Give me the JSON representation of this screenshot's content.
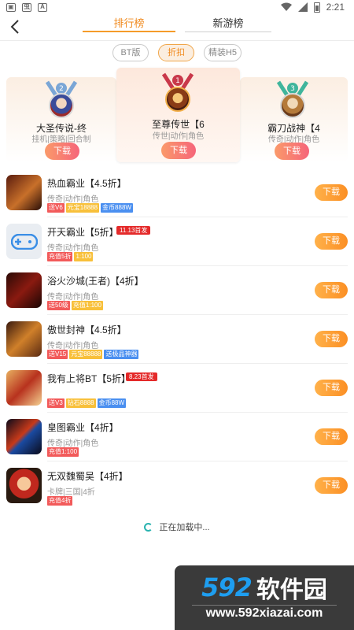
{
  "status": {
    "time": "2:21"
  },
  "header": {
    "tabs": [
      {
        "label": "排行榜",
        "active": true
      },
      {
        "label": "新游榜",
        "active": false
      }
    ]
  },
  "filters": [
    {
      "label": "BT版",
      "active": false
    },
    {
      "label": "折扣",
      "active": true
    },
    {
      "label": "精装H5",
      "active": false
    }
  ],
  "podium": {
    "second": {
      "rank": "2",
      "title": "大圣传说-终",
      "sub": "挂机|策略|回合制",
      "button": "下载"
    },
    "first": {
      "rank": "1",
      "title": "至尊传世【6",
      "sub": "传世|动作|角色",
      "button": "下载"
    },
    "third": {
      "rank": "3",
      "title": "霸刀战神【4",
      "sub": "传奇|动作|角色",
      "button": "下载"
    }
  },
  "games": [
    {
      "title": "热血霸业【4.5折】",
      "category": "传奇|动作|角色",
      "badge": "",
      "button": "下载",
      "tags": [
        {
          "text": "送V6",
          "color": "#f25a5a"
        },
        {
          "text": "元宝18888",
          "color": "#f8c03a"
        },
        {
          "text": "金币888W",
          "color": "#4a8ff0"
        }
      ]
    },
    {
      "title": "开天霸业【5折】",
      "category": "传奇|动作|角色",
      "badge": "11.13首发",
      "button": "下载",
      "tags": [
        {
          "text": "充值5折",
          "color": "#f25a5a"
        },
        {
          "text": "1:100",
          "color": "#f8c03a"
        }
      ]
    },
    {
      "title": "浴火沙城(王者)【4折】",
      "category": "传奇|动作|角色",
      "badge": "",
      "button": "下载",
      "tags": [
        {
          "text": "送50级",
          "color": "#f25a5a"
        },
        {
          "text": "充值1:100",
          "color": "#f8c03a"
        }
      ]
    },
    {
      "title": "傲世封神【4.5折】",
      "category": "传奇|动作|角色",
      "badge": "",
      "button": "下载",
      "tags": [
        {
          "text": "送V15",
          "color": "#f25a5a"
        },
        {
          "text": "元宝88888",
          "color": "#f8c03a"
        },
        {
          "text": "送极品神器",
          "color": "#4a8ff0"
        }
      ]
    },
    {
      "title": "我有上将BT【5折】",
      "category": "",
      "badge": "8.23首发",
      "button": "下载",
      "tags": [
        {
          "text": "送V3",
          "color": "#f25a5a"
        },
        {
          "text": "钻石8888",
          "color": "#f8c03a"
        },
        {
          "text": "金币88W",
          "color": "#4a8ff0"
        }
      ]
    },
    {
      "title": "皇图霸业【4折】",
      "category": "传奇|动作|角色",
      "badge": "",
      "button": "下载",
      "tags": [
        {
          "text": "充值1:100",
          "color": "#f25a5a"
        }
      ]
    },
    {
      "title": "无双魏蜀吴【4折】",
      "category": "卡牌|三国|4折",
      "badge": "",
      "button": "下载",
      "tags": [
        {
          "text": "充值4折",
          "color": "#f25a5a"
        }
      ]
    }
  ],
  "loading": {
    "text": "正在加载中..."
  },
  "watermark": {
    "logo_num": "592",
    "logo_text": "软件园",
    "url": "www.592xiazai.com"
  }
}
